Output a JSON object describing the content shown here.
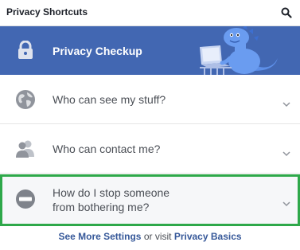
{
  "header": {
    "title": "Privacy Shortcuts",
    "search_icon": "search-icon"
  },
  "checkup": {
    "label": "Privacy Checkup",
    "icon": "lock-icon",
    "illustration": "dinosaur-with-laptop",
    "background": "#4267b2"
  },
  "items": [
    {
      "label": "Who can see my stuff?",
      "icon": "globe-icon"
    },
    {
      "label": "Who can contact me?",
      "icon": "people-icon"
    },
    {
      "label_line1": "How do I stop someone",
      "label_line2": "from bothering me?",
      "icon": "block-icon",
      "selected": true
    }
  ],
  "footer": {
    "see_more": "See More Settings",
    "or_visit": "or visit",
    "privacy_basics": "Privacy Basics"
  },
  "colors": {
    "accent": "#4267b2",
    "highlight_border": "#2ea84a",
    "link": "#365899"
  }
}
